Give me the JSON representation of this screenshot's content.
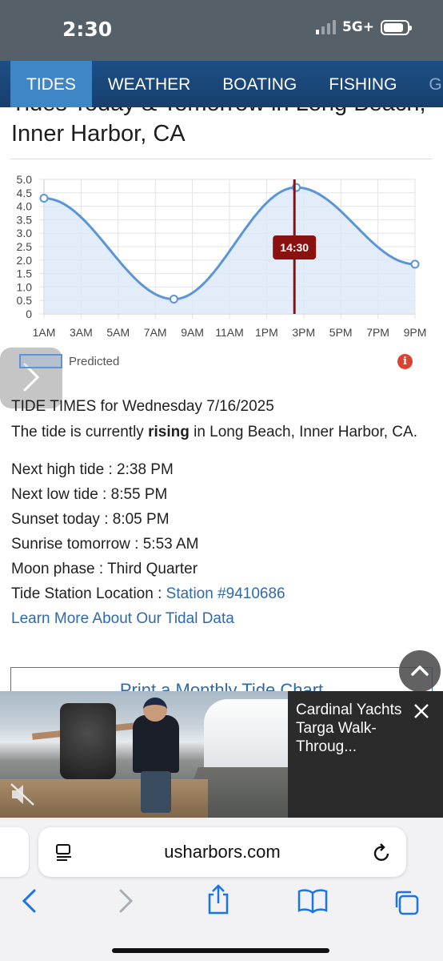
{
  "status_bar": {
    "time": "2:30",
    "network": "5G+",
    "signal_bars_active": 1,
    "battery_level": 0.85
  },
  "nav": {
    "tabs": [
      {
        "label": "TIDES",
        "active": true
      },
      {
        "label": "WEATHER"
      },
      {
        "label": "BOATING"
      },
      {
        "label": "FISHING"
      },
      {
        "label": "G"
      }
    ]
  },
  "page": {
    "heading": "Tides Today & Tomorrow in Long Beach, Inner Harbor, CA"
  },
  "chart_data": {
    "type": "line",
    "x_tick_labels": [
      "1AM",
      "3AM",
      "5AM",
      "7AM",
      "9AM",
      "11AM",
      "1PM",
      "3PM",
      "5PM",
      "7PM",
      "9PM"
    ],
    "x_range_hours": [
      1,
      21
    ],
    "ylim": [
      0,
      5.0
    ],
    "y_tick_labels": [
      "0",
      "0.5",
      "1.0",
      "1.5",
      "2.0",
      "2.5",
      "3.0",
      "3.5",
      "4.0",
      "4.5",
      "5.0"
    ],
    "series": [
      {
        "name": "Predicted",
        "points": [
          {
            "hour": 1.0,
            "value": 4.3
          },
          {
            "hour": 8.0,
            "value": 0.55
          },
          {
            "hour": 14.6,
            "value": 4.7
          },
          {
            "hour": 21.0,
            "value": 1.85
          }
        ]
      }
    ],
    "current_time_marker": {
      "label": "14:30",
      "hour": 14.5
    },
    "grid": true,
    "legend": "bottom-left",
    "colors": {
      "line": "#5b95d9",
      "fill": "#dce9f8",
      "marker": "#8b1010"
    }
  },
  "tide_info": {
    "title": "TIDE TIMES for Wednesday 7/16/2025",
    "desc_prefix": "The tide is currently ",
    "desc_state": "rising",
    "desc_suffix": " in Long Beach, Inner Harbor, CA.",
    "rows": [
      {
        "label": "Next high tide",
        "value": "2:38 PM"
      },
      {
        "label": "Next low tide",
        "value": "8:55 PM"
      },
      {
        "label": "Sunset today",
        "value": "8:05 PM"
      },
      {
        "label": "Sunrise tomorrow",
        "value": "5:53 AM"
      },
      {
        "label": "Moon phase",
        "value": "Third Quarter"
      }
    ],
    "station_label": "Tide Station Location",
    "station_link": "Station #9410686",
    "learn_more": "Learn More About Our Tidal Data",
    "print_button": "Print a Monthly Tide Chart"
  },
  "video": {
    "title": "Cardinal Yachts Targa Walk-Throug..."
  },
  "browser": {
    "url": "usharbors.com"
  }
}
